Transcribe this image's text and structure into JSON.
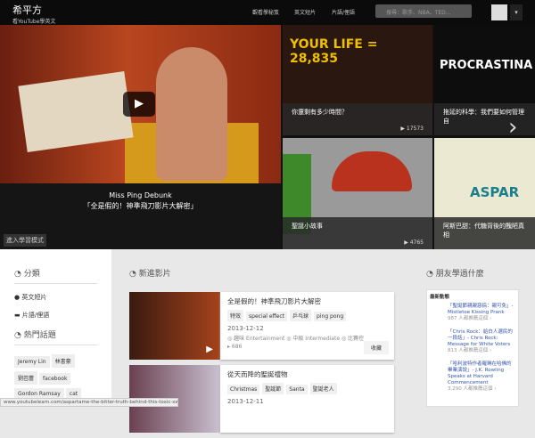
{
  "header": {
    "logo": "希平方",
    "logo_sub": "看YouTube學英文",
    "nav": [
      "觀看學秘笈",
      "英文短片",
      "片語/俚語"
    ],
    "search_placeholder": "搜尋：歌手、NBA、TED..."
  },
  "hero": {
    "main_title": "Miss Ping Debunk",
    "main_subtitle": "「全是假的！神準飛刀影片大解密」",
    "mode_button": "進入學習模式",
    "tiles": [
      {
        "title": "你還剩有多少時間？",
        "views": "17573",
        "bg_text": "YOUR LIFE = 28,835"
      },
      {
        "title": "拖延的科學：我們要如何管理自",
        "views": "",
        "bg_text": "PROCRASTINA"
      },
      {
        "title": "聖誕小故事",
        "views": "4765",
        "bg_text": ""
      },
      {
        "title": "阿斯巴甜：代糖背後的醜陋真相",
        "views": "",
        "bg_text": "ASPAR"
      }
    ]
  },
  "sidebar": {
    "categories_title": "分類",
    "items": [
      "英文短片",
      "片語/俚語"
    ],
    "hot_title": "熱門話題",
    "tags": [
      "Jeremy Lin",
      "林書豪",
      "劉芭蕾",
      "facebook",
      "Gordon Ramsay",
      "cat"
    ]
  },
  "new_videos": {
    "title": "新進影片",
    "cards": [
      {
        "title": "全是假的！神準飛刀影片大解密",
        "tags": [
          "特效",
          "special effect",
          "乒乓球",
          "ping pong"
        ],
        "date": "2013-12-12",
        "meta": "◎ 趣味 Entertainment ◎ 中級 Intermediate ◎ 比賽控",
        "views": "686",
        "fav": "收藏"
      },
      {
        "title": "從天而降的聖誕禮物",
        "tags": [
          "Christmas",
          "聖誕節",
          "Santa",
          "聖誕老人"
        ],
        "date": "2013-12-11",
        "meta": "",
        "views": "",
        "fav": ""
      }
    ]
  },
  "friends": {
    "title": "朋友學過什麼",
    "latest": "最新動態",
    "items": [
      {
        "title": "「聖誕節親親惡搞：親可免」- Mistletoe Kissing Prank",
        "count": "987 人都推薦這個 ›"
      },
      {
        "title": "「Chris Rock：給白人選民的一段話」- Chris Rock: Message for White Voters",
        "count": "813 人都推薦這個 ›"
      },
      {
        "title": "「哈利波特作者羅琳在哈佛的畢業演說」- J.K. Rowling Speaks at Harvard Commencement",
        "count": "3,290 人都推薦這個 ›"
      }
    ]
  },
  "status_url": "www.youtubelearn.com/aspartame-the-bitter-truth-behind-this-toxic-sw..."
}
